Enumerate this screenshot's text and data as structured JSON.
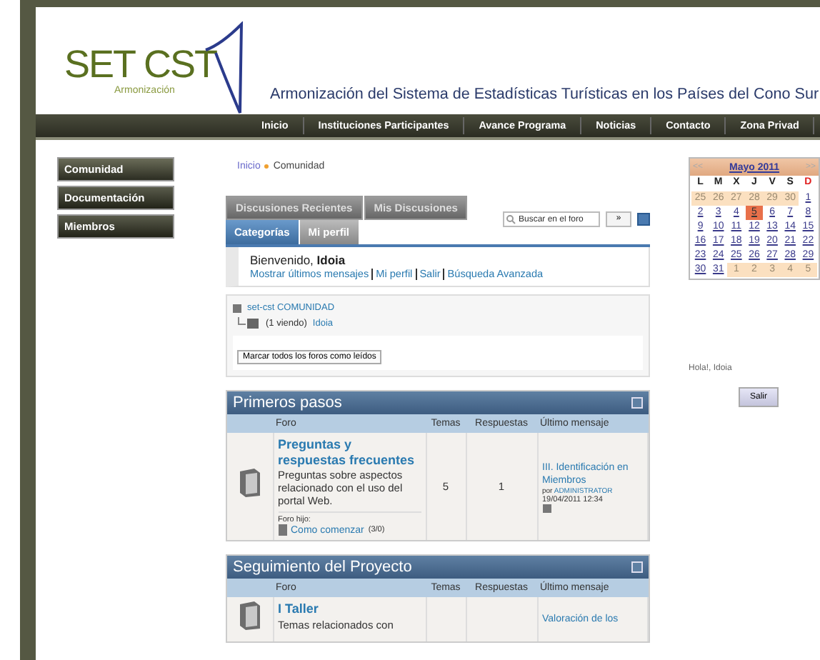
{
  "logo": {
    "name": "SET CST",
    "tagline": "Armonización"
  },
  "site_title": "Armonización del Sistema de Estadísticas Turísticas en los Países del Cono Sur",
  "nav": [
    "Inicio",
    "Instituciones Participantes",
    "Avance Programa",
    "Noticias",
    "Contacto",
    "Zona Privad"
  ],
  "sidebar": {
    "items": [
      {
        "label": "Comunidad",
        "selected": true
      },
      {
        "label": "Documentación",
        "selected": false
      },
      {
        "label": "Miembros",
        "selected": false
      }
    ]
  },
  "breadcrumb": [
    "Inicio",
    "Comunidad"
  ],
  "tabs_top": [
    {
      "label": "Discusiones Recientes",
      "selected": false
    },
    {
      "label": "Mis Discusiones",
      "selected": false
    }
  ],
  "tabs": [
    {
      "label": "Categorías",
      "selected": true
    },
    {
      "label": "Mi perfil",
      "selected": false
    }
  ],
  "search": {
    "placeholder": "Buscar en el foro",
    "go": "»"
  },
  "welcome": {
    "greeting": "Bienvenido, **Idoia**",
    "links": [
      "Mostrar últimos mensajes",
      "Mi perfil",
      "Salir",
      "Búsqueda Avanzada"
    ]
  },
  "online": {
    "group": "set-cst COMUNIDAD",
    "viewing": "(1 viendo)",
    "user": "Idoia",
    "mark_read": "Marcar todos los foros como leídos"
  },
  "categories": [
    {
      "title": "Primeros pasos",
      "columns": [
        "Foro",
        "Temas",
        "Respuestas",
        "Último mensaje"
      ],
      "forums": [
        {
          "title": "Preguntas y respuestas frecuentes",
          "description": "Preguntas sobre aspectos relacionado con el uso del portal Web.",
          "child_label": "Foro hijo:",
          "child": {
            "title": "Como comenzar",
            "count": "(3/0)"
          },
          "topics": "5",
          "replies": "1",
          "last": {
            "title": "III. Identificación en Miembros",
            "by": "por",
            "author": "ADMINISTRATOR",
            "date": "19/04/2011 12:34"
          }
        }
      ]
    },
    {
      "title": "Seguimiento del Proyecto",
      "columns": [
        "Foro",
        "Temas",
        "Respuestas",
        "Último mensaje"
      ],
      "forums": [
        {
          "title": "I Taller",
          "description": "Temas relacionados con",
          "last": {
            "title": "Valoración de los"
          }
        }
      ]
    }
  ],
  "calendar": {
    "month": "Mayo 2011",
    "prev": "<<",
    "next": ">>",
    "weekdays": [
      {
        "label": "L",
        "color": "#222222"
      },
      {
        "label": "M",
        "color": "#222222"
      },
      {
        "label": "X",
        "color": "#222222"
      },
      {
        "label": "J",
        "color": "#222222"
      },
      {
        "label": "V",
        "color": "#222222"
      },
      {
        "label": "S",
        "color": "#222222"
      },
      {
        "label": "D",
        "color": "#e02020"
      }
    ],
    "weeks": [
      [
        {
          "day": "25",
          "other": true,
          "today": false
        },
        {
          "day": "26",
          "other": true,
          "today": false
        },
        {
          "day": "27",
          "other": true,
          "today": false
        },
        {
          "day": "28",
          "other": true,
          "today": false
        },
        {
          "day": "29",
          "other": true,
          "today": false
        },
        {
          "day": "30",
          "other": true,
          "today": false
        },
        {
          "day": "1",
          "other": false,
          "today": false
        }
      ],
      [
        {
          "day": "2",
          "other": false,
          "today": false
        },
        {
          "day": "3",
          "other": false,
          "today": false
        },
        {
          "day": "4",
          "other": false,
          "today": false
        },
        {
          "day": "5",
          "other": false,
          "today": true
        },
        {
          "day": "6",
          "other": false,
          "today": false
        },
        {
          "day": "7",
          "other": false,
          "today": false
        },
        {
          "day": "8",
          "other": false,
          "today": false
        }
      ],
      [
        {
          "day": "9",
          "other": false,
          "today": false
        },
        {
          "day": "10",
          "other": false,
          "today": false
        },
        {
          "day": "11",
          "other": false,
          "today": false
        },
        {
          "day": "12",
          "other": false,
          "today": false
        },
        {
          "day": "13",
          "other": false,
          "today": false
        },
        {
          "day": "14",
          "other": false,
          "today": false
        },
        {
          "day": "15",
          "other": false,
          "today": false
        }
      ],
      [
        {
          "day": "16",
          "other": false,
          "today": false
        },
        {
          "day": "17",
          "other": false,
          "today": false
        },
        {
          "day": "18",
          "other": false,
          "today": false
        },
        {
          "day": "19",
          "other": false,
          "today": false
        },
        {
          "day": "20",
          "other": false,
          "today": false
        },
        {
          "day": "21",
          "other": false,
          "today": false
        },
        {
          "day": "22",
          "other": false,
          "today": false
        }
      ],
      [
        {
          "day": "23",
          "other": false,
          "today": false
        },
        {
          "day": "24",
          "other": false,
          "today": false
        },
        {
          "day": "25",
          "other": false,
          "today": false
        },
        {
          "day": "26",
          "other": false,
          "today": false
        },
        {
          "day": "27",
          "other": false,
          "today": false
        },
        {
          "day": "28",
          "other": false,
          "today": false
        },
        {
          "day": "29",
          "other": false,
          "today": false
        }
      ],
      [
        {
          "day": "30",
          "other": false,
          "today": false
        },
        {
          "day": "31",
          "other": false,
          "today": false
        },
        {
          "day": "1",
          "other": true,
          "today": false
        },
        {
          "day": "2",
          "other": true,
          "today": false
        },
        {
          "day": "3",
          "other": true,
          "today": false
        },
        {
          "day": "4",
          "other": true,
          "today": false
        },
        {
          "day": "5",
          "other": true,
          "today": false
        }
      ]
    ]
  },
  "login": {
    "greeting": "Hola!, Idoia",
    "button": "Salir"
  }
}
